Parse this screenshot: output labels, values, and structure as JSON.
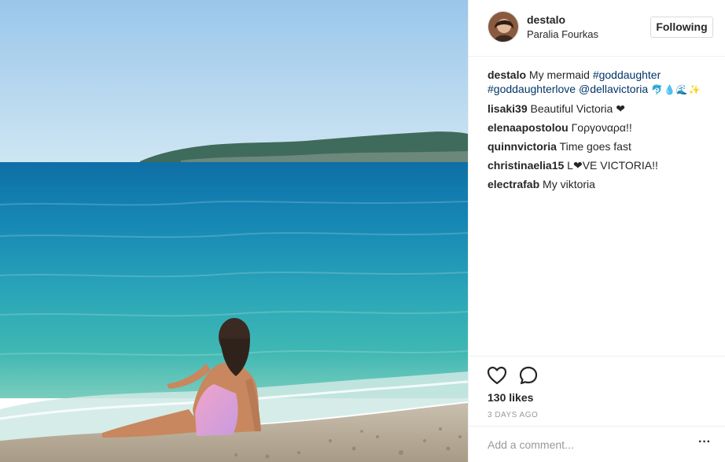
{
  "header": {
    "username": "destalo",
    "location": "Paralia Fourkas",
    "follow_label": "Following"
  },
  "caption": {
    "author": "destalo",
    "text": "My mermaid ",
    "tag1": "#goddaughter",
    "tag2": "#goddaughterlove",
    "mention": "@dellavictoria",
    "emojis": "🐬💧🌊✨"
  },
  "comments": [
    {
      "author": "lisaki39",
      "text": "Beautiful Victoria ❤"
    },
    {
      "author": "elenaapostolou",
      "text": "Γοργοναρα!!"
    },
    {
      "author": "quinnvictoria",
      "text": "Time goes fast"
    },
    {
      "author": "christinaelia15",
      "text": "L❤VE VICTORIA!!"
    },
    {
      "author": "electrafab",
      "text": "My viktoria"
    }
  ],
  "actions": {
    "like_icon": "heart-outline-icon",
    "comment_icon": "speech-bubble-icon",
    "likes": "130 likes",
    "time": "3 DAYS AGO"
  },
  "add_comment": {
    "placeholder": "Add a comment...",
    "more_label": "···"
  },
  "colors": {
    "link": "#003569",
    "text": "#262626",
    "muted": "#999999",
    "border": "#efefef"
  }
}
